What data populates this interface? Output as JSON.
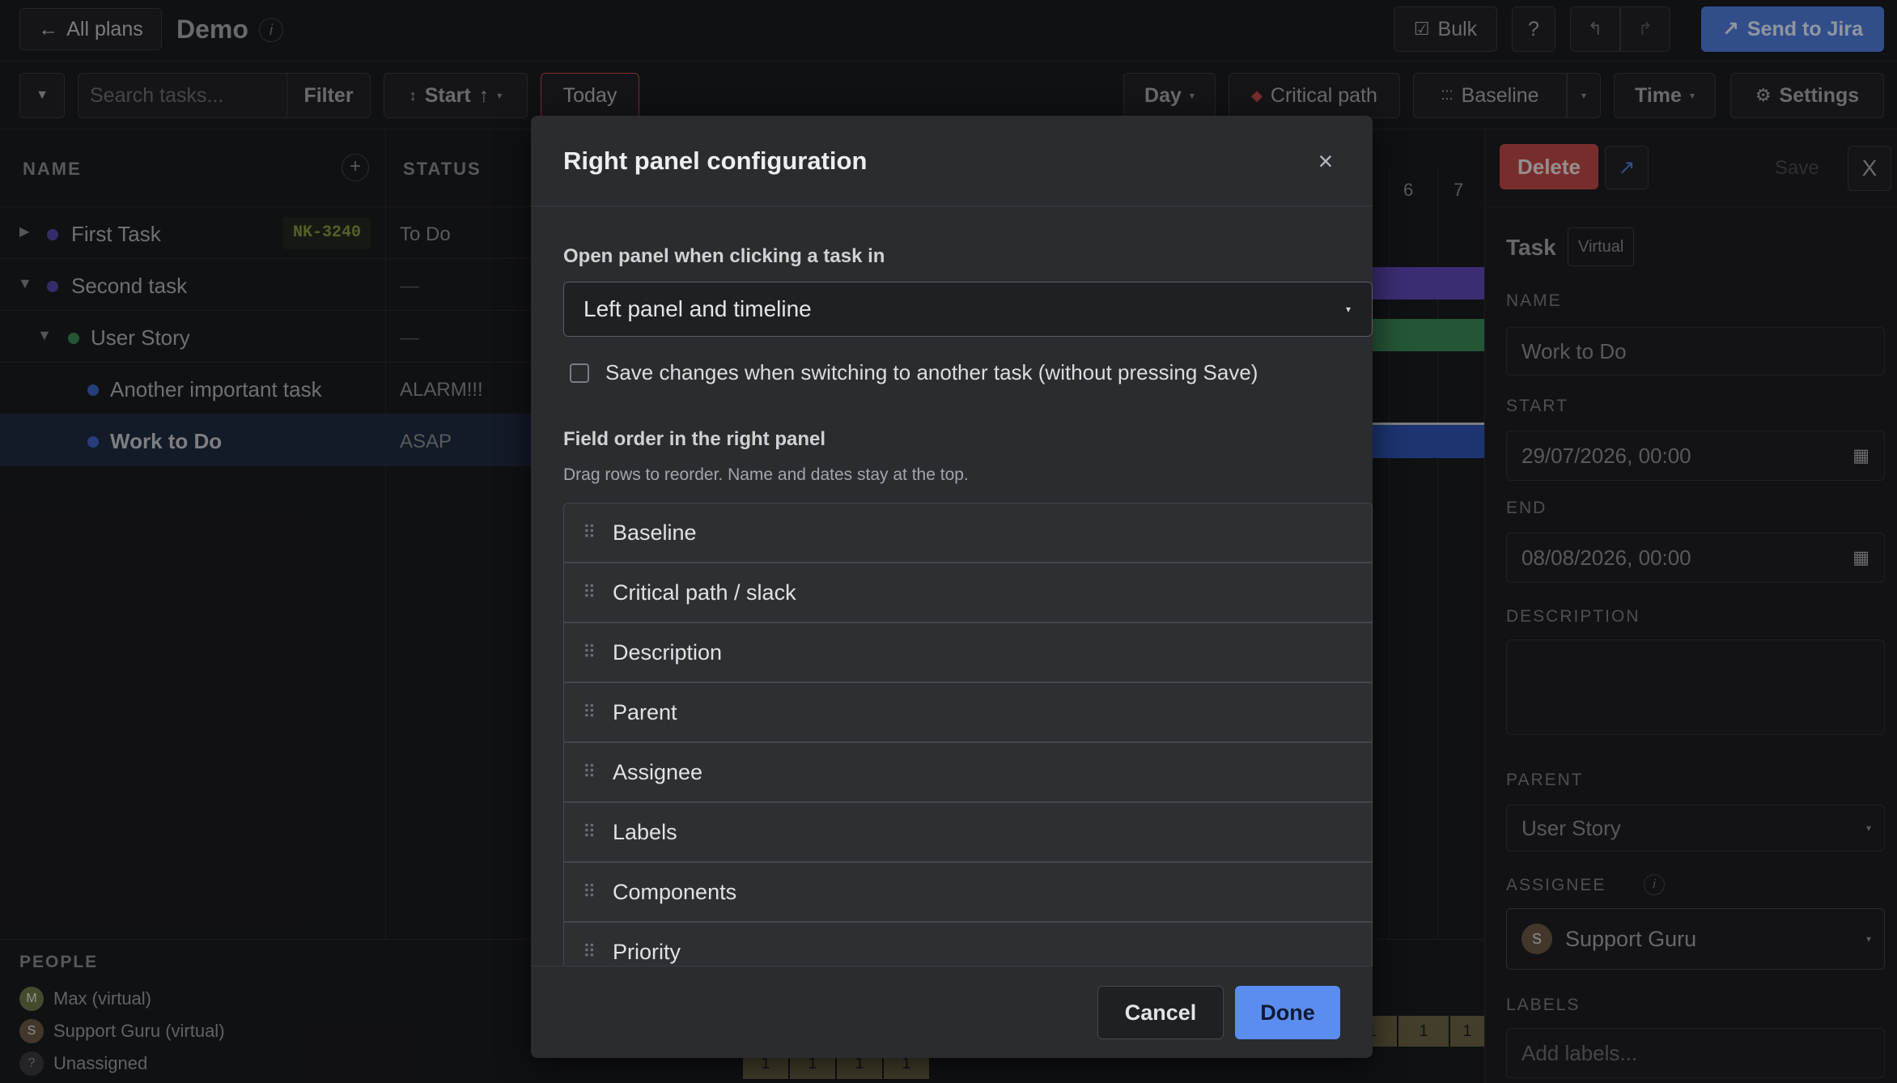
{
  "topbar": {
    "back_label": "All plans",
    "plan_title": "Demo",
    "info_glyph": "i",
    "bulk_label": "Bulk",
    "help_label": "?",
    "send_label": "Send to Jira"
  },
  "toolbar": {
    "search_placeholder": "Search tasks...",
    "filter_label": "Filter",
    "sort_label": "Start",
    "today_label": "Today",
    "day_label": "Day",
    "critical_label": "Critical path",
    "baseline_label": "Baseline",
    "time_label": "Time",
    "settings_label": "Settings"
  },
  "table": {
    "name_header": "NAME",
    "status_header": "STATUS",
    "rows": [
      {
        "name": "First Task",
        "badge": "NK-3240",
        "status": "To Do"
      },
      {
        "name": "Second task",
        "status": "—"
      },
      {
        "name": "User Story",
        "status": "—"
      },
      {
        "name": "Another important task",
        "status": "ALARM!!!"
      },
      {
        "name": "Work to Do",
        "status": "ASAP"
      }
    ]
  },
  "timeline": {
    "days": [
      "6",
      "7"
    ],
    "counts": [
      "1",
      "1",
      "1",
      "1",
      "1",
      "1",
      "1",
      "1"
    ]
  },
  "people": {
    "header": "PEOPLE",
    "items": [
      {
        "initial": "M",
        "name": "Max (virtual)"
      },
      {
        "initial": "S",
        "name": "Support Guru (virtual)"
      },
      {
        "initial": "?",
        "name": "Unassigned"
      }
    ]
  },
  "rpanel": {
    "delete_label": "Delete",
    "save_label": "Save",
    "close_label": "X",
    "task_label": "Task",
    "virtual_badge": "Virtual",
    "name_label": "NAME",
    "name_value": "Work to Do",
    "start_label": "START",
    "start_value": "29/07/2026, 00:00",
    "end_label": "END",
    "end_value": "08/08/2026, 00:00",
    "description_label": "DESCRIPTION",
    "parent_label": "PARENT",
    "parent_value": "User Story",
    "assignee_label": "ASSIGNEE",
    "assignee_initial": "S",
    "assignee_value": "Support Guru",
    "labels_label": "LABELS",
    "labels_placeholder": "Add labels..."
  },
  "modal": {
    "title": "Right panel configuration",
    "open_panel_label": "Open panel when clicking a task in",
    "open_panel_value": "Left panel and timeline",
    "save_switch_label": "Save changes when switching to another task (without pressing Save)",
    "save_switch_checked": false,
    "field_order_title": "Field order in the right panel",
    "field_order_hint": "Drag rows to reorder. Name and dates stay at the top.",
    "fields": [
      "Baseline",
      "Critical path / slack",
      "Description",
      "Parent",
      "Assignee",
      "Labels",
      "Components",
      "Priority"
    ],
    "cancel_label": "Cancel",
    "done_label": "Done"
  },
  "colors": {
    "accent": "#4f7fe0",
    "delete": "#c24a4a",
    "bar_purple": "#6148b8",
    "bar_green": "#3a8a57",
    "bar_blue": "#2f55b8"
  }
}
